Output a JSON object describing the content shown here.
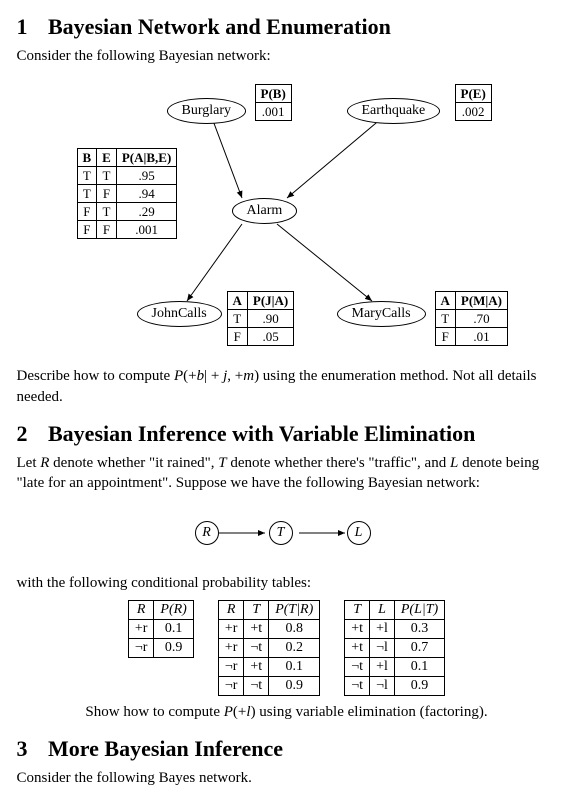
{
  "section1": {
    "number": "1",
    "title": "Bayesian Network and Enumeration",
    "intro": "Consider the following Bayesian network:",
    "question": "Describe how to compute P(+b| + j, +m) using the enumeration method. Not all details needed.",
    "nodes": {
      "burglary": "Burglary",
      "earthquake": "Earthquake",
      "alarm": "Alarm",
      "john": "JohnCalls",
      "mary": "MaryCalls"
    },
    "cpt_b": {
      "h1": "P(B)",
      "v": ".001"
    },
    "cpt_e": {
      "h1": "P(E)",
      "v": ".002"
    },
    "cpt_a": {
      "h": [
        "B",
        "E",
        "P(A|B,E)"
      ],
      "rows": [
        [
          "T",
          "T",
          ".95"
        ],
        [
          "T",
          "F",
          ".94"
        ],
        [
          "F",
          "T",
          ".29"
        ],
        [
          "F",
          "F",
          ".001"
        ]
      ]
    },
    "cpt_j": {
      "h": [
        "A",
        "P(J|A)"
      ],
      "rows": [
        [
          "T",
          ".90"
        ],
        [
          "F",
          ".05"
        ]
      ]
    },
    "cpt_m": {
      "h": [
        "A",
        "P(M|A)"
      ],
      "rows": [
        [
          "T",
          ".70"
        ],
        [
          "F",
          ".01"
        ]
      ]
    }
  },
  "section2": {
    "number": "2",
    "title": "Bayesian Inference with Variable Elimination",
    "intro_pre": "Let ",
    "intro_r": "R",
    "intro_mid1": " denote whether \"it rained\", ",
    "intro_t": "T",
    "intro_mid2": " denote whether there's \"traffic\", and ",
    "intro_l": "L",
    "intro_mid3": " denote being \"late for an appointment\". Suppose we have the following Bayesian network:",
    "nodes": {
      "r": "R",
      "t": "T",
      "l": "L"
    },
    "tables_intro": "with the following conditional probability tables:",
    "table_r": {
      "h": [
        "R",
        "P(R)"
      ],
      "rows": [
        [
          "+r",
          "0.1"
        ],
        [
          "¬r",
          "0.9"
        ]
      ]
    },
    "table_tr": {
      "h": [
        "R",
        "T",
        "P(T|R)"
      ],
      "rows": [
        [
          "+r",
          "+t",
          "0.8"
        ],
        [
          "+r",
          "¬t",
          "0.2"
        ],
        [
          "¬r",
          "+t",
          "0.1"
        ],
        [
          "¬r",
          "¬t",
          "0.9"
        ]
      ]
    },
    "table_lt": {
      "h": [
        "T",
        "L",
        "P(L|T)"
      ],
      "rows": [
        [
          "+t",
          "+l",
          "0.3"
        ],
        [
          "+t",
          "¬l",
          "0.7"
        ],
        [
          "¬t",
          "+l",
          "0.1"
        ],
        [
          "¬t",
          "¬l",
          "0.9"
        ]
      ]
    },
    "question": "Show how to compute P(+l) using variable elimination (factoring)."
  },
  "section3": {
    "number": "3",
    "title": "More Bayesian Inference",
    "intro": "Consider the following Bayes network."
  },
  "chart_data": [
    {
      "type": "table",
      "title": "CPT P(B)",
      "rows": [
        [
          "P(B)"
        ],
        [
          ".001"
        ]
      ]
    },
    {
      "type": "table",
      "title": "CPT P(E)",
      "rows": [
        [
          "P(E)"
        ],
        [
          ".002"
        ]
      ]
    },
    {
      "type": "table",
      "title": "CPT P(A|B,E)",
      "rows": [
        [
          "B",
          "E",
          "P(A|B,E)"
        ],
        [
          "T",
          "T",
          ".95"
        ],
        [
          "T",
          "F",
          ".94"
        ],
        [
          "F",
          "T",
          ".29"
        ],
        [
          "F",
          "F",
          ".001"
        ]
      ]
    },
    {
      "type": "table",
      "title": "CPT P(J|A)",
      "rows": [
        [
          "A",
          "P(J|A)"
        ],
        [
          "T",
          ".90"
        ],
        [
          "F",
          ".05"
        ]
      ]
    },
    {
      "type": "table",
      "title": "CPT P(M|A)",
      "rows": [
        [
          "A",
          "P(M|A)"
        ],
        [
          "T",
          ".70"
        ],
        [
          "F",
          ".01"
        ]
      ]
    },
    {
      "type": "table",
      "title": "P(R)",
      "rows": [
        [
          "R",
          "P(R)"
        ],
        [
          "+r",
          "0.1"
        ],
        [
          "¬r",
          "0.9"
        ]
      ]
    },
    {
      "type": "table",
      "title": "P(T|R)",
      "rows": [
        [
          "R",
          "T",
          "P(T|R)"
        ],
        [
          "+r",
          "+t",
          "0.8"
        ],
        [
          "+r",
          "¬t",
          "0.2"
        ],
        [
          "¬r",
          "+t",
          "0.1"
        ],
        [
          "¬r",
          "¬t",
          "0.9"
        ]
      ]
    },
    {
      "type": "table",
      "title": "P(L|T)",
      "rows": [
        [
          "T",
          "L",
          "P(L|T)"
        ],
        [
          "+t",
          "+l",
          "0.3"
        ],
        [
          "+t",
          "¬l",
          "0.7"
        ],
        [
          "¬t",
          "+l",
          "0.1"
        ],
        [
          "¬t",
          "¬l",
          "0.9"
        ]
      ]
    }
  ]
}
